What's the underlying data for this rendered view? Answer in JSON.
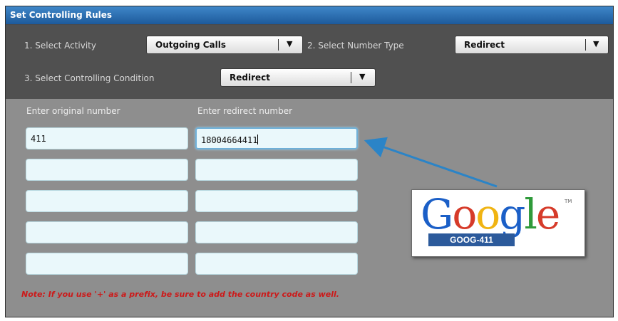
{
  "panel": {
    "title": "Set Controlling Rules"
  },
  "step1": {
    "label": "1. Select Activity",
    "value": "Outgoing Calls"
  },
  "step2": {
    "label": "2. Select Number Type",
    "value": "Redirect"
  },
  "step3": {
    "label": "3. Select Controlling Condition",
    "value": "Redirect"
  },
  "columns": {
    "original": "Enter original number",
    "redirect": "Enter redirect number"
  },
  "rows": [
    {
      "original": "411",
      "redirect": "18004664411"
    },
    {
      "original": "",
      "redirect": ""
    },
    {
      "original": "",
      "redirect": ""
    },
    {
      "original": "",
      "redirect": ""
    },
    {
      "original": "",
      "redirect": ""
    }
  ],
  "note": "Note: If you use '+' as a prefix, be sure to add the country code as well.",
  "logo": {
    "word": "Google",
    "tm": "TM",
    "caption": "GOOG-411"
  },
  "colors": {
    "accent": "#1d5a9b",
    "note": "#cc1a1a",
    "arrow": "#2b84c7"
  }
}
